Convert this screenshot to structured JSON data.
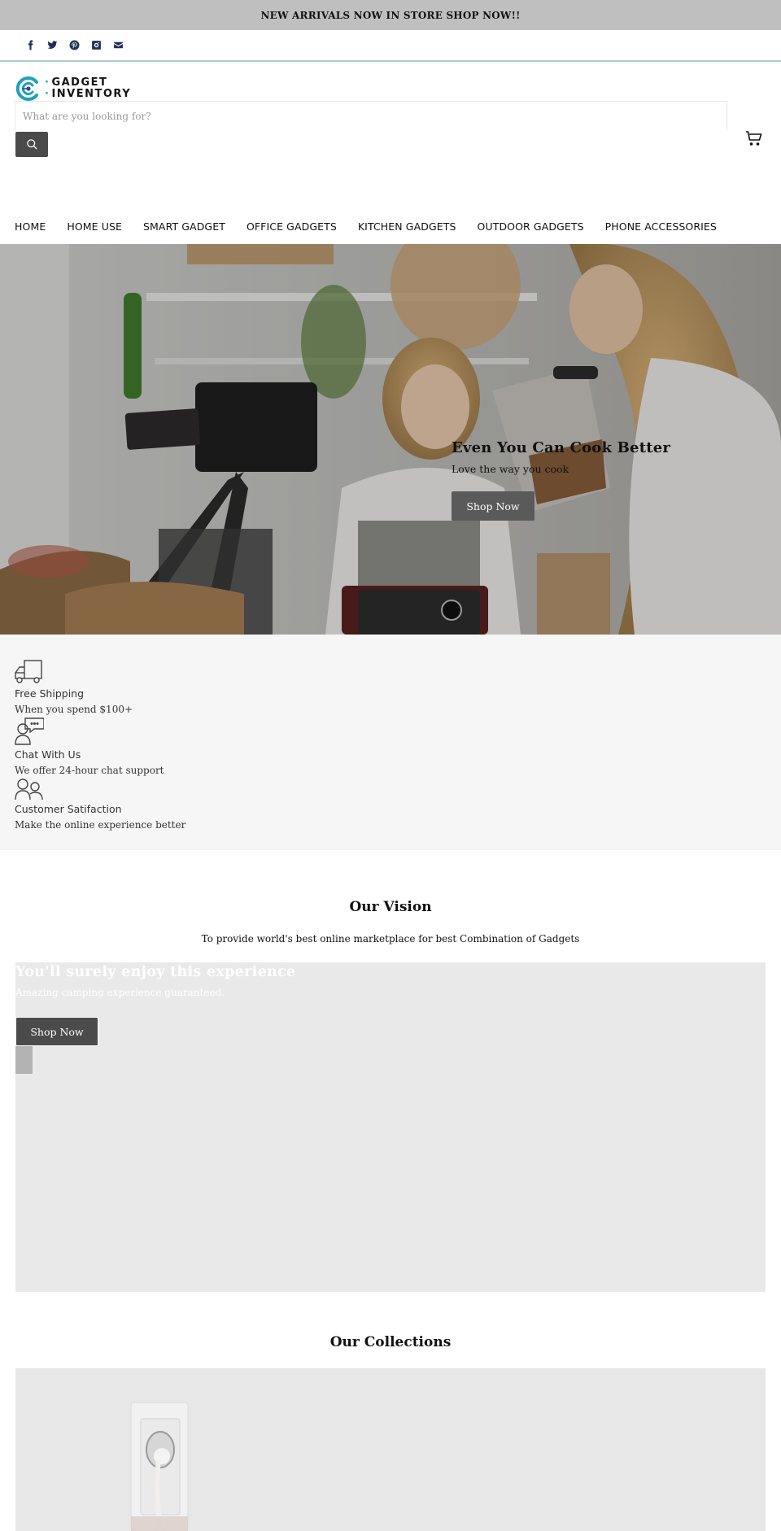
{
  "announcement": {
    "text": "NEW ARRIVALS NOW IN STORE SHOP NOW!!"
  },
  "social": [
    {
      "icon": "facebook-icon",
      "label": "Facebook"
    },
    {
      "icon": "twitter-icon",
      "label": "Twitter"
    },
    {
      "icon": "pinterest-icon",
      "label": "Pinterest"
    },
    {
      "icon": "instagram-icon",
      "label": "Instagram"
    },
    {
      "icon": "email-icon",
      "label": "Email"
    }
  ],
  "header": {
    "logo": {
      "line1": "GADGET",
      "line2": "INVENTORY",
      "accent_color": "#1ea2b5",
      "dot_color": "#3b3f9a"
    },
    "search": {
      "placeholder": "What are you looking for?",
      "value": ""
    },
    "search_button_icon": "search-icon",
    "cart_icon": "cart-icon"
  },
  "nav": {
    "items": [
      {
        "label": "HOME"
      },
      {
        "label": "HOME USE"
      },
      {
        "label": "SMART GADGET"
      },
      {
        "label": "OFFICE GADGETS"
      },
      {
        "label": "KITCHEN GADGETS"
      },
      {
        "label": "OUTDOOR GADGETS"
      },
      {
        "label": "PHONE ACCESSORIES"
      }
    ]
  },
  "hero": {
    "title": "Even You Can Cook Better",
    "subtitle": "Love the way you cook",
    "button": "Shop Now",
    "image_description": "Mother and daughter cooking in kitchen with camera on tripod"
  },
  "features": [
    {
      "icon": "truck-icon",
      "title": "Free Shipping",
      "subtitle": "When you spend $100+"
    },
    {
      "icon": "chat-support-icon",
      "title": "Chat With Us",
      "subtitle": "We offer 24-hour chat support"
    },
    {
      "icon": "users-icon",
      "title": "Customer Satifaction",
      "subtitle": "Make the online experience better"
    }
  ],
  "vision": {
    "title": "Our Vision",
    "text": "To provide world's best online marketplace for best Combination of Gadgets"
  },
  "promo": {
    "title": "You'll surely enjoy this experience",
    "subtitle": "Amazing camping experience guaranteed.",
    "button": "Shop Now"
  },
  "collections": {
    "title": "Our Collections",
    "image_description": "White wall power socket with plug"
  },
  "colors": {
    "announcement_bg": "#bfbfbf",
    "divider": "#a9cfd0",
    "button_dark": "#4a4a4a",
    "features_bg": "#f6f6f6",
    "promo_bg": "#e9e9e9",
    "social_icon": "#1f3157"
  }
}
